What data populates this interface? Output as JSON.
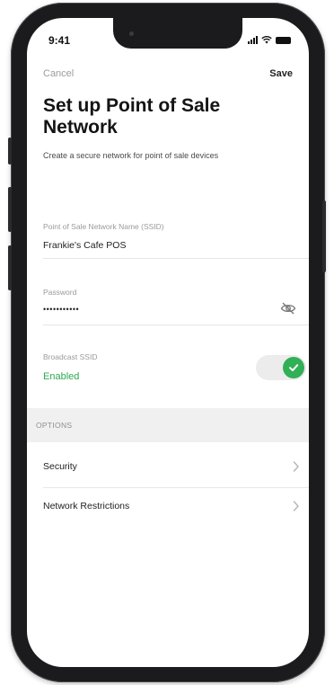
{
  "status_bar": {
    "time": "9:41"
  },
  "nav": {
    "cancel_label": "Cancel",
    "save_label": "Save"
  },
  "header": {
    "title": "Set up Point of Sale Network",
    "subtitle": "Create a secure network for point of sale devices"
  },
  "fields": {
    "ssid": {
      "label": "Point of Sale Network Name (SSID)",
      "value": "Frankie's Cafe POS"
    },
    "password": {
      "label": "Password",
      "value": "•••••••••••"
    },
    "broadcast": {
      "label": "Broadcast SSID",
      "status": "Enabled",
      "on": true
    }
  },
  "options": {
    "section_label": "OPTIONS",
    "items": [
      {
        "label": "Security"
      },
      {
        "label": "Network Restrictions"
      }
    ]
  },
  "colors": {
    "accent_green": "#31b057",
    "enabled_text": "#2fa84f",
    "section_bg": "#f0f0f0",
    "frame": "#1b1b1d"
  },
  "icons": {
    "password_toggle": "eye-slash-icon",
    "row_chevron": "chevron-right-icon",
    "toggle_check": "check-icon"
  }
}
